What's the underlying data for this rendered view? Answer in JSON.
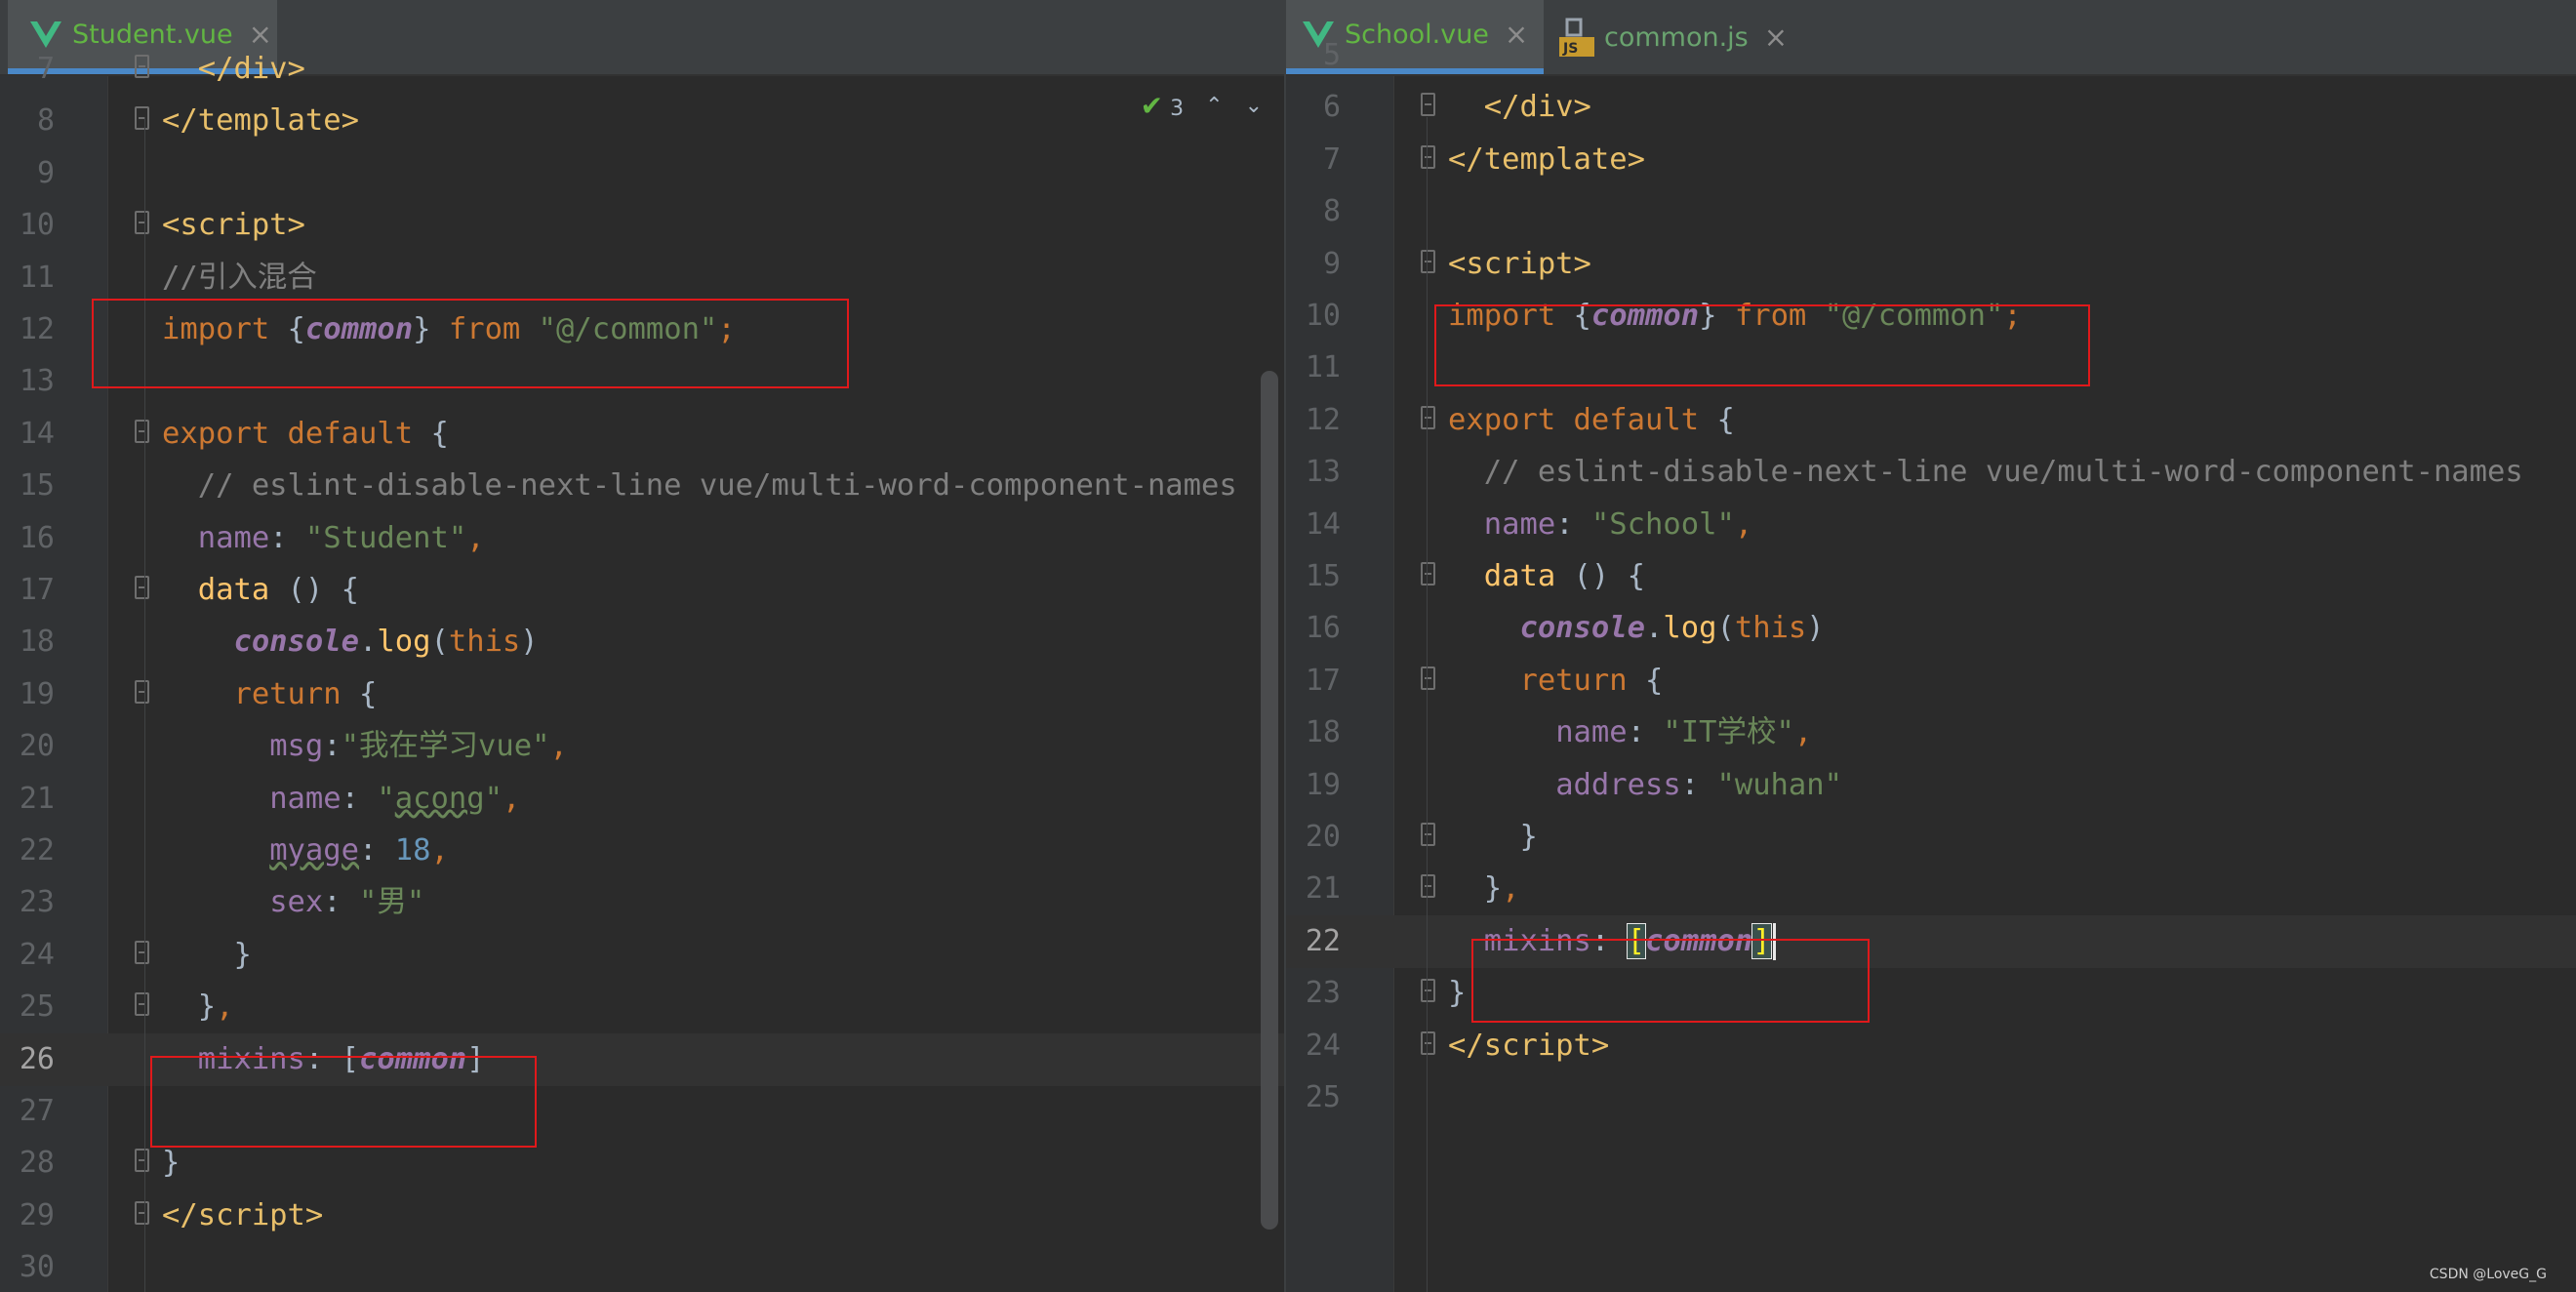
{
  "left": {
    "tabs": [
      {
        "name": "Student.vue",
        "close": "×"
      }
    ],
    "inspection": {
      "count": "3",
      "up": "⌃",
      "down": "⌄"
    },
    "lines": [
      {
        "n": "7",
        "html": "  <span class=\"tag\">&lt;/div&gt;</span>",
        "fold": true
      },
      {
        "n": "8",
        "html": "<span class=\"tag\">&lt;/template&gt;</span>",
        "fold": true
      },
      {
        "n": "9",
        "html": ""
      },
      {
        "n": "10",
        "html": "<span class=\"tag\">&lt;script&gt;</span>",
        "fold": true
      },
      {
        "n": "11",
        "html": "<span class=\"cmt\">//引入混合</span>"
      },
      {
        "n": "12",
        "html": "<span class=\"kw\">import</span> {<span class=\"ital\">common</span>} <span class=\"kw\">from</span> <span class=\"str\">\"@/common\"</span><span class=\"kw\">;</span>"
      },
      {
        "n": "13",
        "html": ""
      },
      {
        "n": "14",
        "html": "<span class=\"kw\">export default</span> {",
        "fold": true
      },
      {
        "n": "15",
        "html": "  <span class=\"cmt\">// eslint-disable-next-line vue/multi-word-component-names</span>"
      },
      {
        "n": "16",
        "html": "  <span class=\"prop\">name</span>: <span class=\"str\">\"Student\"</span><span class=\"kw\">,</span>"
      },
      {
        "n": "17",
        "html": "  <span class=\"fn\">data</span> () {",
        "fold": true
      },
      {
        "n": "18",
        "html": "    <span class=\"ital\">console</span>.<span class=\"fn\">log</span>(<span class=\"kw\">this</span>)"
      },
      {
        "n": "19",
        "html": "    <span class=\"kw\">return</span> {",
        "fold": true
      },
      {
        "n": "20",
        "html": "      <span class=\"prop\">msg</span>:<span class=\"str\">\"我在学习vue\"</span><span class=\"kw\">,</span>"
      },
      {
        "n": "21",
        "html": "      <span class=\"prop\">name</span>: <span class=\"str\">\"<span class=\"typo\">acong</span>\"</span><span class=\"kw\">,</span>"
      },
      {
        "n": "22",
        "html": "      <span class=\"prop typo\">myage</span>: <span class=\"num\">18</span><span class=\"kw\">,</span>"
      },
      {
        "n": "23",
        "html": "      <span class=\"prop\">sex</span>: <span class=\"str\">\"男\"</span>"
      },
      {
        "n": "24",
        "html": "    }",
        "fold": true
      },
      {
        "n": "25",
        "html": "  }<span class=\"kw\">,</span>",
        "fold": true
      },
      {
        "n": "26",
        "html": "  <span class=\"prop\">mixins</span>: [<span class=\"ital\">common</span>]",
        "current": true
      },
      {
        "n": "27",
        "html": ""
      },
      {
        "n": "28",
        "html": "}",
        "fold": true
      },
      {
        "n": "29",
        "html": "<span class=\"tag\">&lt;/script&gt;</span>",
        "fold": true
      },
      {
        "n": "30",
        "html": ""
      }
    ]
  },
  "right": {
    "tabs": [
      {
        "name": "School.vue",
        "close": "×"
      },
      {
        "name": "common.js",
        "close": "×"
      }
    ],
    "lines": [
      {
        "n": "5",
        "html": ""
      },
      {
        "n": "6",
        "html": "  <span class=\"tag\">&lt;/div&gt;</span>",
        "fold": true
      },
      {
        "n": "7",
        "html": "<span class=\"tag\">&lt;/template&gt;</span>",
        "fold": true
      },
      {
        "n": "8",
        "html": ""
      },
      {
        "n": "9",
        "html": "<span class=\"tag\">&lt;script&gt;</span>",
        "fold": true
      },
      {
        "n": "10",
        "html": "<span class=\"kw\">import</span> {<span class=\"ital\">common</span>} <span class=\"kw\">from</span> <span class=\"str\">\"@/common\"</span><span class=\"kw\">;</span>"
      },
      {
        "n": "11",
        "html": ""
      },
      {
        "n": "12",
        "html": "<span class=\"kw\">export default</span> {",
        "fold": true
      },
      {
        "n": "13",
        "html": "  <span class=\"cmt\">// eslint-disable-next-line vue/multi-word-component-names</span>"
      },
      {
        "n": "14",
        "html": "  <span class=\"prop\">name</span>: <span class=\"str\">\"School\"</span><span class=\"kw\">,</span>"
      },
      {
        "n": "15",
        "html": "  <span class=\"fn\">data</span> () {",
        "fold": true
      },
      {
        "n": "16",
        "html": "    <span class=\"ital\">console</span>.<span class=\"fn\">log</span>(<span class=\"kw\">this</span>)"
      },
      {
        "n": "17",
        "html": "    <span class=\"kw\">return</span> {",
        "fold": true
      },
      {
        "n": "18",
        "html": "      <span class=\"prop\">name</span>: <span class=\"str\">\"IT学校\"</span><span class=\"kw\">,</span>"
      },
      {
        "n": "19",
        "html": "      <span class=\"prop\">address</span>: <span class=\"str\">\"wuhan\"</span>"
      },
      {
        "n": "20",
        "html": "    }",
        "fold": true
      },
      {
        "n": "21",
        "html": "  }<span class=\"kw\">,</span>",
        "fold": true
      },
      {
        "n": "22",
        "html": "  <span class=\"prop\">mixins</span>: <span class=\"brace-hl\">[</span><span class=\"ital\">common</span><span class=\"brace-hl\">]</span><span class=\"caret\"></span>",
        "current": true
      },
      {
        "n": "23",
        "html": "}",
        "fold": true
      },
      {
        "n": "24",
        "html": "<span class=\"tag\">&lt;/script&gt;</span>",
        "fold": true
      },
      {
        "n": "25",
        "html": ""
      }
    ]
  },
  "watermark": "CSDN @LoveG_G"
}
